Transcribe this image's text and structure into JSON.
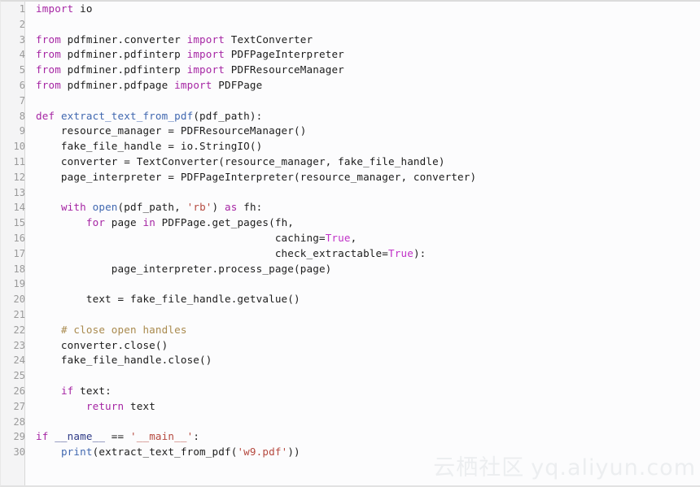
{
  "viewer": {
    "language": "python",
    "background_color": "#fcfcfd",
    "gutter_color": "#f4f4f5",
    "line_number_color": "#9a9a9a",
    "total_lines": 30
  },
  "palette": {
    "keyword": "#a626a4",
    "boolean": "#c031c7",
    "function": "#4168b0",
    "string": "#b5493f",
    "comment": "#a98a4e",
    "dunder": "#2e3a86",
    "plain": "#1c1c1c"
  },
  "line_numbers": [
    "1",
    "2",
    "3",
    "4",
    "5",
    "6",
    "7",
    "8",
    "9",
    "10",
    "11",
    "12",
    "13",
    "14",
    "15",
    "16",
    "17",
    "18",
    "19",
    "20",
    "21",
    "22",
    "23",
    "24",
    "25",
    "26",
    "27",
    "28",
    "29",
    "30"
  ],
  "code": {
    "lines": [
      {
        "n": "1",
        "text": "import io"
      },
      {
        "n": "2",
        "text": ""
      },
      {
        "n": "3",
        "text": "from pdfminer.converter import TextConverter"
      },
      {
        "n": "4",
        "text": "from pdfminer.pdfinterp import PDFPageInterpreter"
      },
      {
        "n": "5",
        "text": "from pdfminer.pdfinterp import PDFResourceManager"
      },
      {
        "n": "6",
        "text": "from pdfminer.pdfpage import PDFPage"
      },
      {
        "n": "7",
        "text": ""
      },
      {
        "n": "8",
        "text": "def extract_text_from_pdf(pdf_path):"
      },
      {
        "n": "9",
        "text": "    resource_manager = PDFResourceManager()"
      },
      {
        "n": "10",
        "text": "    fake_file_handle = io.StringIO()"
      },
      {
        "n": "11",
        "text": "    converter = TextConverter(resource_manager, fake_file_handle)"
      },
      {
        "n": "12",
        "text": "    page_interpreter = PDFPageInterpreter(resource_manager, converter)"
      },
      {
        "n": "13",
        "text": ""
      },
      {
        "n": "14",
        "text": "    with open(pdf_path, 'rb') as fh:"
      },
      {
        "n": "15",
        "text": "        for page in PDFPage.get_pages(fh,"
      },
      {
        "n": "16",
        "text": "                                      caching=True,"
      },
      {
        "n": "17",
        "text": "                                      check_extractable=True):"
      },
      {
        "n": "18",
        "text": "            page_interpreter.process_page(page)"
      },
      {
        "n": "19",
        "text": ""
      },
      {
        "n": "20",
        "text": "        text = fake_file_handle.getvalue()"
      },
      {
        "n": "21",
        "text": ""
      },
      {
        "n": "22",
        "text": "    # close open handles"
      },
      {
        "n": "23",
        "text": "    converter.close()"
      },
      {
        "n": "24",
        "text": "    fake_file_handle.close()"
      },
      {
        "n": "25",
        "text": ""
      },
      {
        "n": "26",
        "text": "    if text:"
      },
      {
        "n": "27",
        "text": "        return text"
      },
      {
        "n": "28",
        "text": ""
      },
      {
        "n": "29",
        "text": "if __name__ == '__main__':"
      },
      {
        "n": "30",
        "text": "    print(extract_text_from_pdf('w9.pdf'))"
      }
    ],
    "tokens": {
      "l1": [
        [
          "import",
          "kw"
        ],
        [
          " io",
          "pl"
        ]
      ],
      "l3": [
        [
          "from",
          "kw"
        ],
        [
          " pdfminer.converter ",
          "pl"
        ],
        [
          "import",
          "kw"
        ],
        [
          " TextConverter",
          "pl"
        ]
      ],
      "l4": [
        [
          "from",
          "kw"
        ],
        [
          " pdfminer.pdfinterp ",
          "pl"
        ],
        [
          "import",
          "kw"
        ],
        [
          " PDFPageInterpreter",
          "pl"
        ]
      ],
      "l5": [
        [
          "from",
          "kw"
        ],
        [
          " pdfminer.pdfinterp ",
          "pl"
        ],
        [
          "import",
          "kw"
        ],
        [
          " PDFResourceManager",
          "pl"
        ]
      ],
      "l6": [
        [
          "from",
          "kw"
        ],
        [
          " pdfminer.pdfpage ",
          "pl"
        ],
        [
          "import",
          "kw"
        ],
        [
          " PDFPage",
          "pl"
        ]
      ],
      "l8": [
        [
          "def",
          "kw"
        ],
        [
          " ",
          "pl"
        ],
        [
          "extract_text_from_pdf",
          "fn"
        ],
        [
          "(pdf_path):",
          "pl"
        ]
      ],
      "l14": [
        [
          "    ",
          "pl"
        ],
        [
          "with",
          "kw"
        ],
        [
          " ",
          "pl"
        ],
        [
          "open",
          "fn"
        ],
        [
          "(pdf_path, ",
          "pl"
        ],
        [
          "'rb'",
          "str"
        ],
        [
          ") ",
          "pl"
        ],
        [
          "as",
          "kw"
        ],
        [
          " fh:",
          "pl"
        ]
      ],
      "l15": [
        [
          "        ",
          "pl"
        ],
        [
          "for",
          "kw"
        ],
        [
          " page ",
          "pl"
        ],
        [
          "in",
          "kw"
        ],
        [
          " PDFPage.get_pages(fh,",
          "pl"
        ]
      ],
      "l16": [
        [
          "                                      caching=",
          "pl"
        ],
        [
          "True",
          "bool"
        ],
        [
          ",",
          "pl"
        ]
      ],
      "l17": [
        [
          "                                      check_extractable=",
          "pl"
        ],
        [
          "True",
          "bool"
        ],
        [
          "):",
          "pl"
        ]
      ],
      "l22": [
        [
          "    ",
          "pl"
        ],
        [
          "# close open handles",
          "cmt"
        ]
      ],
      "l26": [
        [
          "    ",
          "pl"
        ],
        [
          "if",
          "kw"
        ],
        [
          " text:",
          "pl"
        ]
      ],
      "l27": [
        [
          "        ",
          "pl"
        ],
        [
          "return",
          "kw"
        ],
        [
          " text",
          "pl"
        ]
      ],
      "l29": [
        [
          "if",
          "kw"
        ],
        [
          " ",
          "pl"
        ],
        [
          "__name__",
          "dund"
        ],
        [
          " == ",
          "pl"
        ],
        [
          "'__main__'",
          "str"
        ],
        [
          ":",
          "pl"
        ]
      ],
      "l30": [
        [
          "    ",
          "pl"
        ],
        [
          "print",
          "fn"
        ],
        [
          "(extract_text_from_pdf(",
          "pl"
        ],
        [
          "'w9.pdf'",
          "str"
        ],
        [
          "))",
          "pl"
        ]
      ]
    }
  },
  "watermark": {
    "chinese": "云栖社区",
    "domain": "yq.aliyun.com",
    "color": "#eceef0"
  }
}
